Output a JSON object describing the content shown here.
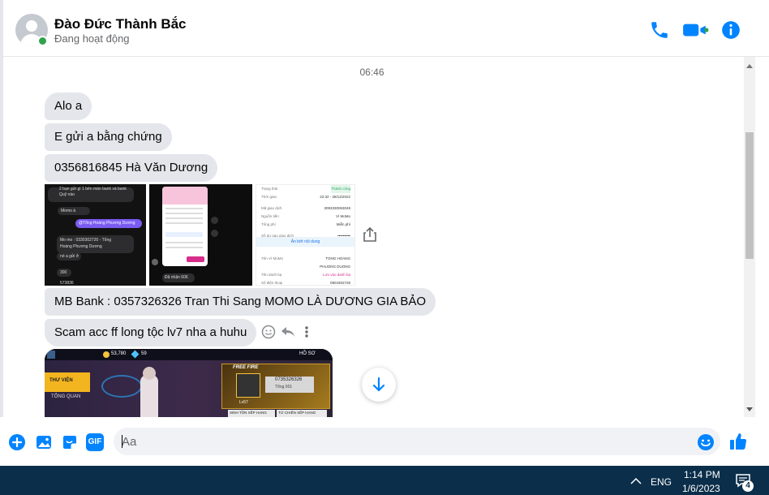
{
  "header": {
    "contact_name": "Đào Đức Thành Bắc",
    "status": "Đang hoạt động",
    "icons": [
      "phone-icon",
      "video-camera-icon",
      "info-icon"
    ]
  },
  "conversation": {
    "timestamp": "06:46",
    "messages": [
      {
        "text": "Alo a"
      },
      {
        "text": "E gửi a bằng chứng"
      },
      {
        "text": "0356816845 Hà Văn Dương"
      },
      {
        "text": "MB Bank : 0357326326 Tran Thi Sang MOMO LÀ DƯƠNG GIA BẢO"
      },
      {
        "text": "Scam acc ff long tộc lv7 nha a huhu"
      }
    ],
    "attachments": {
      "shot1": {
        "lines": [
          "2 bạn gửi gì 1 bên màn bank và bank",
          "Quỹ nào",
          "Momo à",
          "@Tổng Hoàng Phương Dương",
          "Mo mo : 0330302720 - Tổng",
          "Hoàng Phương Dương",
          "nó a gửi ở",
          "300",
          "573836"
        ]
      },
      "shot2": {
        "lines": [
          "Đã nhận 606"
        ]
      },
      "shot3": {
        "rows": [
          {
            "label": "Trạng thái",
            "value": "Thành công"
          },
          {
            "label": "Thời gian",
            "value": "22:32 - 28/12/2022"
          },
          {
            "label": "Mã giao dịch",
            "value": "3093330063048"
          },
          {
            "label": "Nguồn tiền",
            "value": "Ví MoMo"
          },
          {
            "label": "Tổng phí",
            "value": "Miễn phí"
          },
          {
            "label": "Số dư sau giao dịch",
            "value": "••••••••••"
          },
          {
            "label": "Tên Ví MoMo",
            "value": "TONG HOANG PHUONG DUONG"
          },
          {
            "label": "Tên danh bạ",
            "value": "Lưu vào danh bạ"
          },
          {
            "label": "Số điện thoại",
            "value": "0904302728"
          }
        ],
        "button": "Ẩn bớt nội dung"
      },
      "game": {
        "coins": "53,780",
        "diamonds": "59",
        "tab_left_1": "THƯ VIỆN",
        "tab_left_2": "TỔNG QUAN",
        "logo": "FREE FIRE",
        "card_id": "0735326326",
        "card_tag": "Tổng 001",
        "level": "Lv57",
        "btn1": "SINH TỒN XẾP HẠNG",
        "btn2": "TỬ CHIẾN XẾP HẠNG",
        "corner": "HỒ SƠ"
      }
    }
  },
  "composer": {
    "placeholder": "Aa",
    "icons": [
      "plus-circle-icon",
      "image-icon",
      "sticker-icon",
      "gif-icon",
      "emoji-icon",
      "thumbs-up-icon"
    ],
    "gif_label": "GIF"
  },
  "taskbar": {
    "language": "ENG",
    "time": "1:14 PM",
    "date": "1/6/2023",
    "notification_count": "4"
  },
  "colors": {
    "accent": "#0084ff",
    "bubble": "#e4e6eb",
    "online": "#31a24c",
    "taskbar": "#0b2f4a"
  }
}
